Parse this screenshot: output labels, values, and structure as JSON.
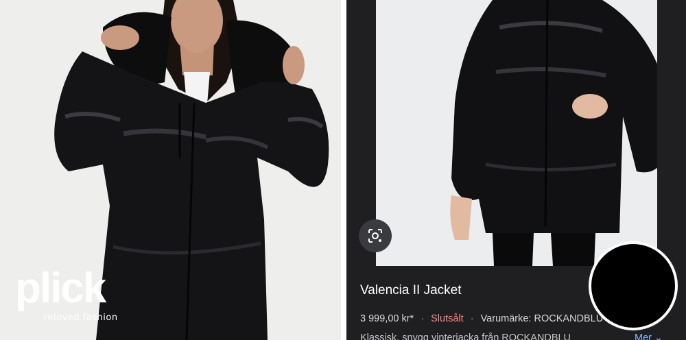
{
  "logo": {
    "word": "plick",
    "tagline": "reloved fashion"
  },
  "result": {
    "title": "Valencia II Jacket",
    "price": "3 999,00 kr*",
    "separator": "·",
    "status": "Slutsålt",
    "brand": "Varumärke: ROCKANDBLU",
    "description": "Klassisk, snygg vinterjacka från ROCKANDBLU",
    "more_label": "Mer ⌄"
  },
  "icons": {
    "lens": "google-lens-icon"
  },
  "colors": {
    "panel": "#1f1f22",
    "sold": "#f28b82",
    "link": "#8ab4f8"
  }
}
